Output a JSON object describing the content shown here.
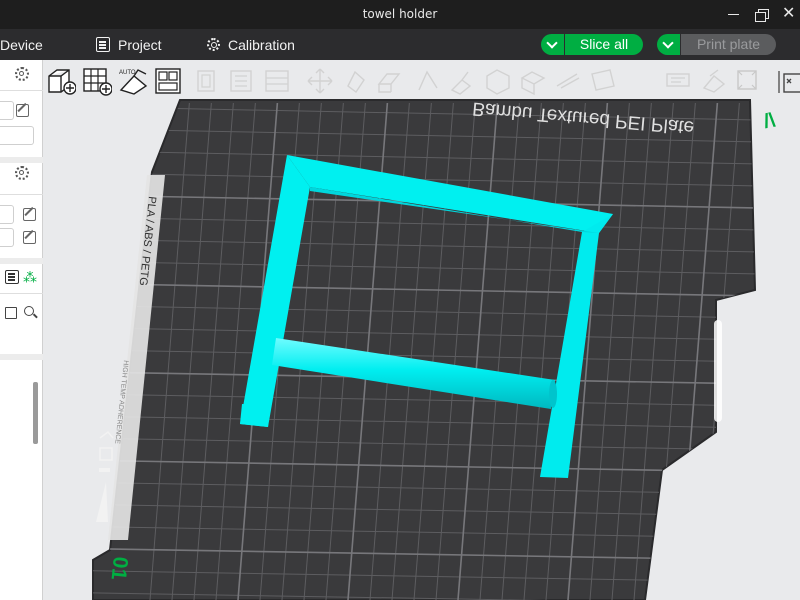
{
  "window": {
    "title": "towel holder",
    "close_glyph": "✕"
  },
  "menubar": {
    "device_label": "Device",
    "project_label": "Project",
    "calibration_label": "Calibration",
    "slice_label": "Slice all",
    "print_label": "Print plate"
  },
  "canvas_toolbar": {
    "auto_badge": "AUTO",
    "icons": [
      "add-cube-icon",
      "grid-add-icon",
      "auto-orient-icon",
      "arrange-icon",
      "copy-icon",
      "split-icon",
      "layers-icon",
      "move-icon",
      "rotate-icon",
      "scale-icon",
      "cut-icon",
      "support-paint-icon",
      "seam-paint-icon",
      "color-paint-icon",
      "measure-icon",
      "assembly-icon",
      "text-icon",
      "view-icon",
      "more-icon"
    ]
  },
  "bed": {
    "brand_text": "Bambu Textured PEI Plate",
    "material_text": "PLA / ABS / PETG",
    "side_text": "HIGH TEMP ADHERENCE",
    "plate_number": "01",
    "corner_mark": "/\\"
  },
  "left_panel": {
    "icons": [
      "gear-icon",
      "edit-icon",
      "edit-icon",
      "gear-icon",
      "edit-icon",
      "edit-icon",
      "list-icon",
      "objects-icon",
      "save-icon",
      "search-icon"
    ]
  },
  "colors": {
    "accent": "#00ae42",
    "model": "#00f0f0",
    "bed": "#3a3a3c",
    "titlebar": "#1e1e1e",
    "menubar": "#2c2c2e"
  }
}
